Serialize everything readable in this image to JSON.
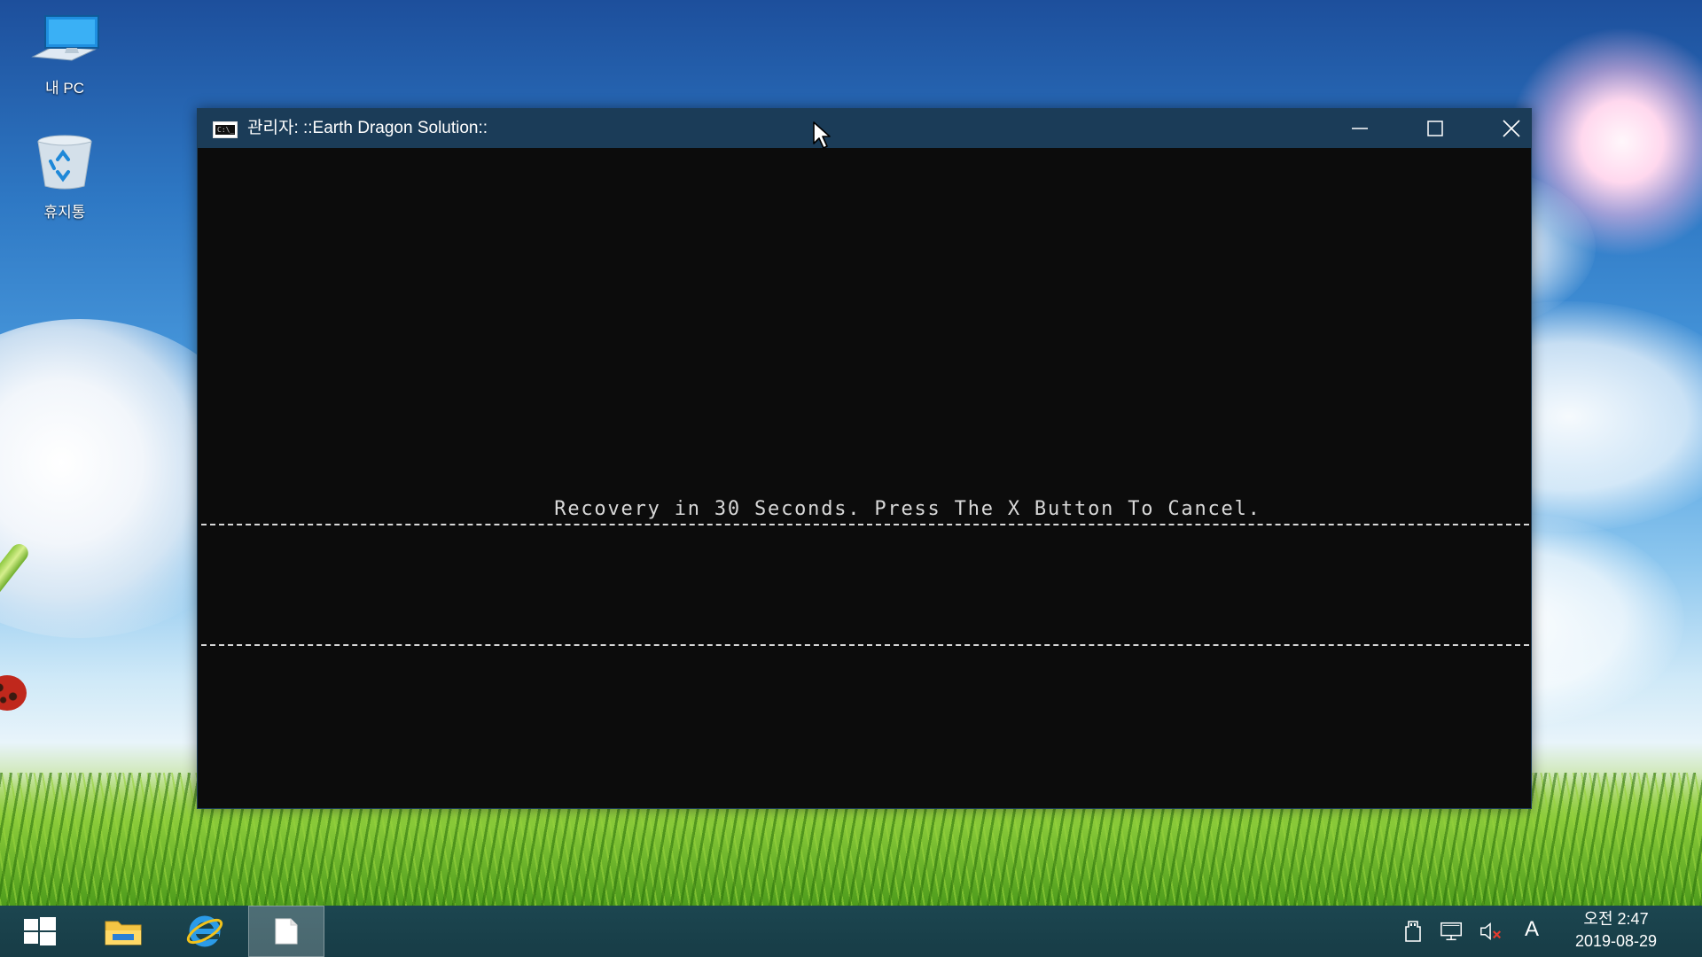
{
  "desktop": {
    "icons": [
      {
        "label": "내 PC",
        "icon": "computer-icon"
      },
      {
        "label": "휴지통",
        "icon": "recycle-bin-icon"
      }
    ]
  },
  "console": {
    "title": "관리자:  ::Earth Dragon Solution::",
    "message": "Recovery in 30 Seconds. Press The X Button To Cancel.",
    "colors": {
      "titlebar": "#1b3c58",
      "background": "#0c0c0c",
      "text": "#d8d8d8"
    }
  },
  "taskbar": {
    "apps": [
      "start-button",
      "file-explorer",
      "internet-explorer",
      "console-window"
    ],
    "tray": {
      "ime": "A",
      "time": "오전 2:47",
      "date": "2019-08-29"
    }
  }
}
